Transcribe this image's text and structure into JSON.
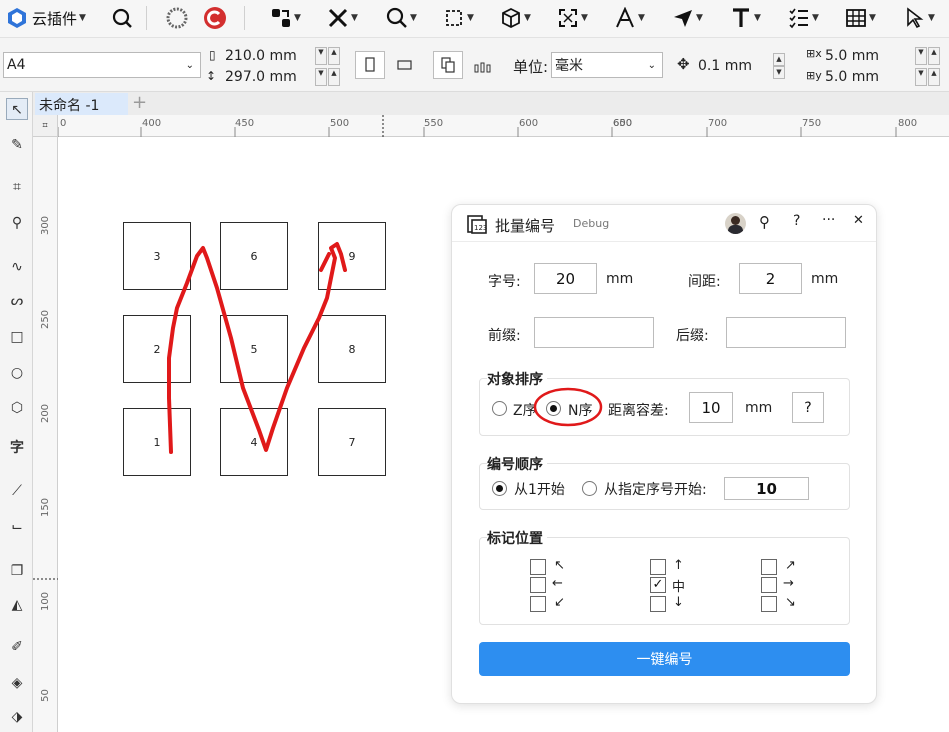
{
  "toolbar": {
    "plugin_label": "云插件",
    "icons": [
      "search-icon",
      "ring-icon",
      "logo-c-icon",
      "node-tool-icon",
      "cross-icon",
      "zoom-tool-icon",
      "crop-icon",
      "cube-icon",
      "expand-icon",
      "font-a-icon",
      "send-icon",
      "text-T-icon",
      "checklist-icon",
      "table-icon",
      "pointer-icon"
    ]
  },
  "propbar": {
    "page_size": "A4",
    "width": "210.0 mm",
    "height": "297.0 mm",
    "unit_label": "单位:",
    "unit_value": "毫米",
    "nudge": "0.1 mm",
    "dup_x": "5.0 mm",
    "dup_y": "5.0 mm"
  },
  "tab": {
    "doc_name": "未命名 -1",
    "add": "+"
  },
  "ruler": {
    "h_ticks": [
      "0",
      "400",
      "450",
      "500",
      "550",
      "600",
      "650",
      "700",
      "750",
      "800"
    ],
    "v_ticks": [
      "300",
      "250",
      "200",
      "150",
      "100",
      "50"
    ]
  },
  "canvas": {
    "boxes": [
      "3",
      "6",
      "9",
      "2",
      "5",
      "8",
      "1",
      "4",
      "7"
    ]
  },
  "dialog": {
    "title": "批量编号",
    "debug": "Debug",
    "pin": "⚲",
    "help": "?",
    "more": "···",
    "close": "✕",
    "font_size_label": "字号:",
    "font_size": "20",
    "font_size_unit": "mm",
    "spacing_label": "间距:",
    "spacing": "2",
    "spacing_unit": "mm",
    "prefix_label": "前缀:",
    "prefix": "",
    "suffix_label": "后缀:",
    "suffix": "",
    "sort_title": "对象排序",
    "z_order": "Z序",
    "n_order": "N序",
    "tolerance_label": "距离容差:",
    "tolerance": "10",
    "tolerance_unit": "mm",
    "tolerance_help": "?",
    "numbering_title": "编号顺序",
    "start_from_1": "从1开始",
    "start_from_custom": "从指定序号开始:",
    "start_value": "10",
    "mark_title": "标记位置",
    "arrows": [
      "↖",
      "←",
      "↙",
      "↑",
      "中",
      "↓",
      "↗",
      "→",
      "↘"
    ],
    "center_checked": "✓",
    "button": "一键编号"
  }
}
